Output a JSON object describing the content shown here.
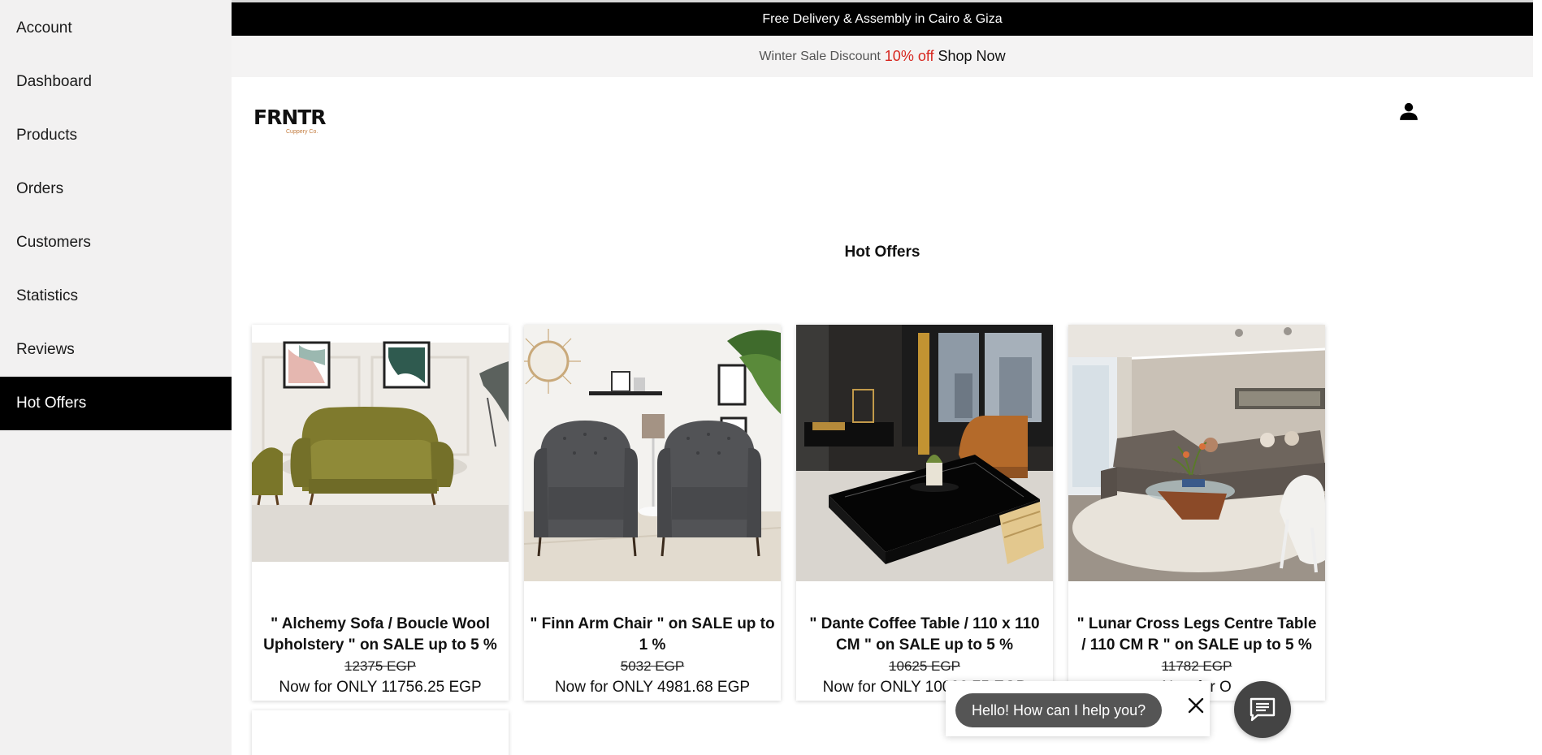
{
  "sidebar": {
    "items": [
      {
        "label": "Account"
      },
      {
        "label": "Dashboard"
      },
      {
        "label": "Products"
      },
      {
        "label": "Orders"
      },
      {
        "label": "Customers"
      },
      {
        "label": "Statistics"
      },
      {
        "label": "Reviews"
      },
      {
        "label": "Hot Offers",
        "active": true
      }
    ]
  },
  "announcement": {
    "text": "Free Delivery & Assembly in Cairo & Giza"
  },
  "sale_bar": {
    "prefix": "Winter Sale Discount",
    "percent": "10% off",
    "link": "Shop Now"
  },
  "brand": {
    "name": "FRNTR",
    "tagline": "Cuppery Co."
  },
  "page": {
    "title": "Hot Offers"
  },
  "products": [
    {
      "name": "\" Alchemy Sofa / Boucle Wool Upholstery \" on SALE up to 5 %",
      "old_price": "12375 EGP",
      "new_price": "Now for ONLY 11756.25 EGP"
    },
    {
      "name": "\" Finn Arm Chair \" on SALE up to 1 %",
      "old_price": "5032 EGP",
      "new_price": "Now for ONLY 4981.68 EGP"
    },
    {
      "name": "\" Dante Coffee Table / 110 x 110 CM \" on SALE up to 5 %",
      "old_price": "10625 EGP",
      "new_price": "Now for ONLY 10093.75 EGP"
    },
    {
      "name": "\" Lunar Cross Legs Centre Table / 110 CM R \" on SALE up to 5 %",
      "old_price": "11782 EGP",
      "new_price": "Now for O"
    }
  ],
  "chat": {
    "greeting": "Hello! How can I help you?"
  },
  "colors": {
    "sidebar_bg": "#f2f1f1",
    "active_bg": "#000000",
    "accent_red": "#d7261e",
    "chat_bg": "#444444"
  },
  "icons": [
    "user-icon",
    "close-icon",
    "chat-icon"
  ]
}
